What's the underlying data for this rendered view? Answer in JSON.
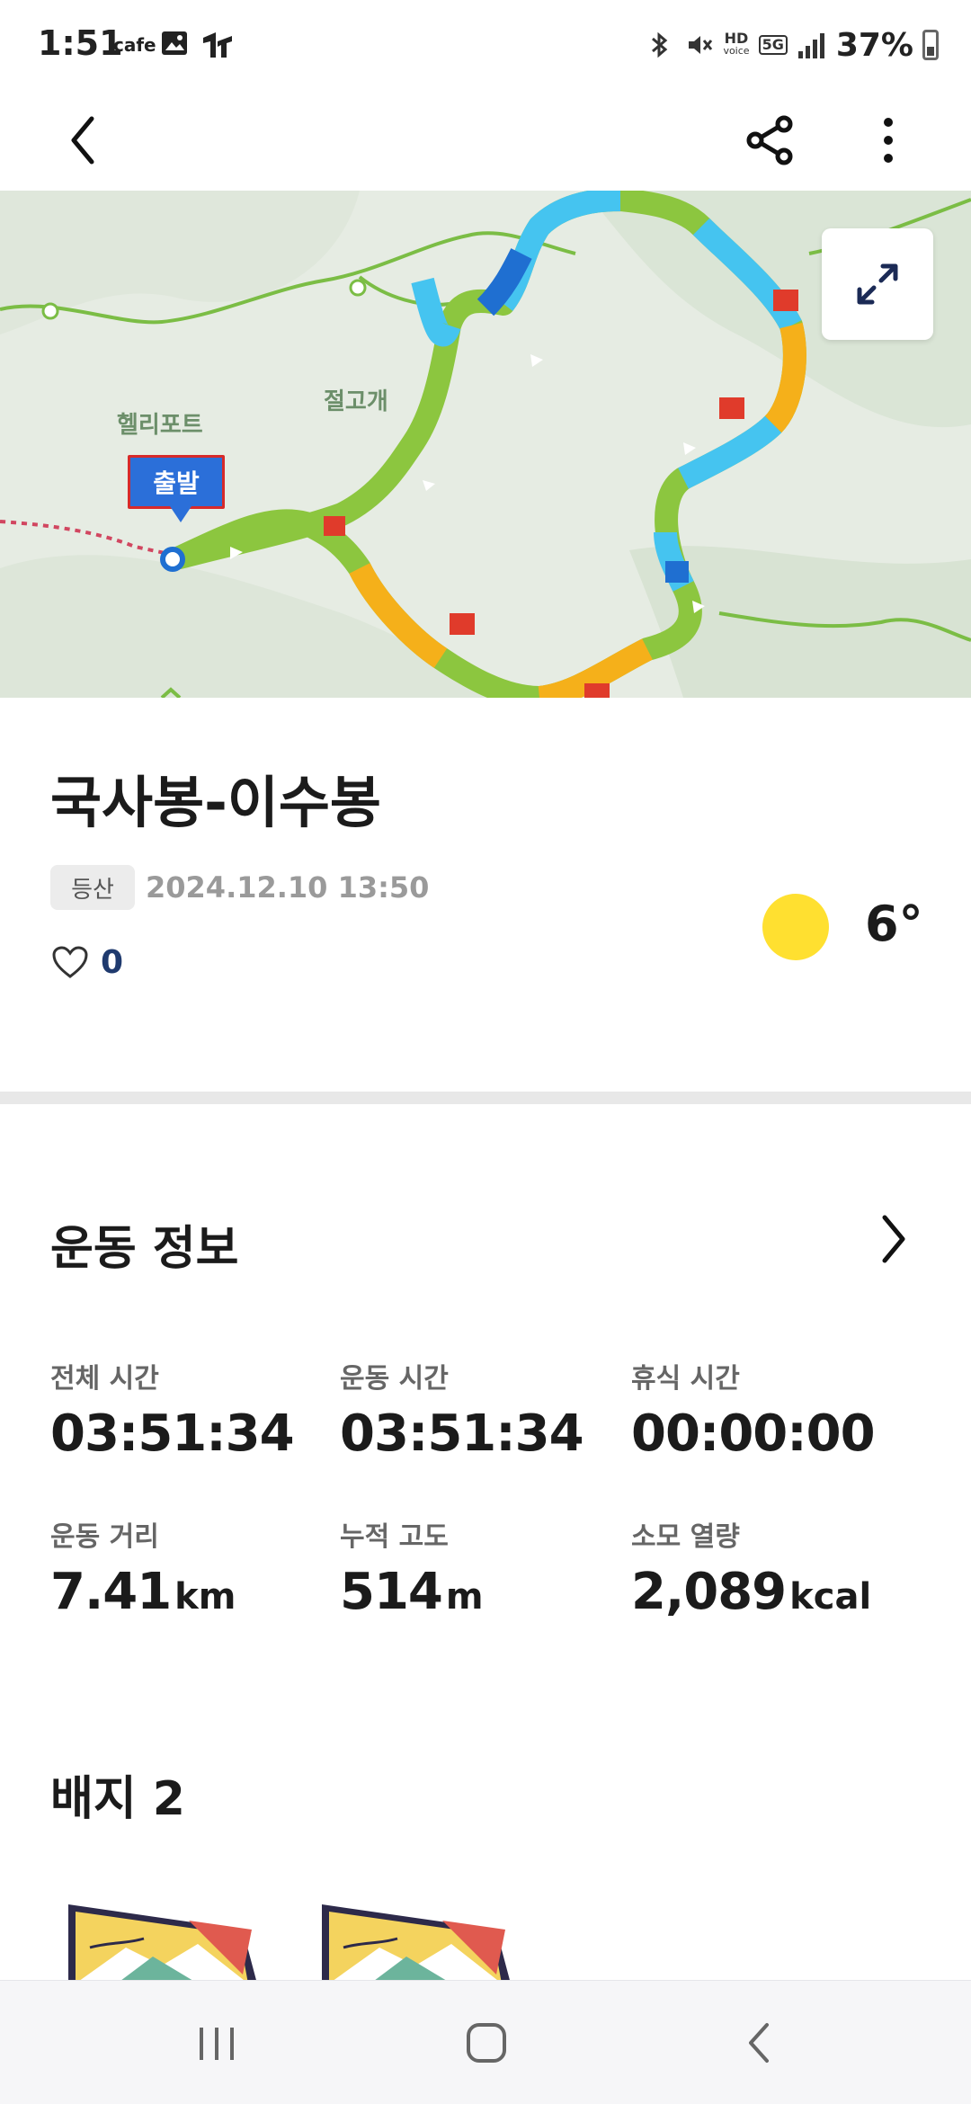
{
  "status_bar": {
    "time": "1:51",
    "cafe_label": "cafe",
    "hd_label": "HD",
    "voice_label": "voice",
    "network": "5G",
    "battery": "37%"
  },
  "app_bar": {
    "back_icon": "chevron-left-icon",
    "share_icon": "share-icon",
    "more_icon": "more-vertical-icon"
  },
  "map": {
    "labels": {
      "heliport": "헬리포트",
      "pass": "절고개"
    },
    "start_marker": "출발",
    "expand_icon": "expand-icon",
    "route_colors": [
      "#8cc63f",
      "#45c4f0",
      "#1f6fd1",
      "#f5b01a",
      "#e03b2b"
    ]
  },
  "activity": {
    "title": "국사봉-이수봉",
    "category": "등산",
    "datetime": "2024.12.10 13:50",
    "likes": "0",
    "weather_icon": "sun-icon",
    "temperature": "6°"
  },
  "exercise_info": {
    "title": "운동 정보",
    "stats": [
      {
        "label": "전체 시간",
        "value": "03:51:34",
        "unit": ""
      },
      {
        "label": "운동 시간",
        "value": "03:51:34",
        "unit": ""
      },
      {
        "label": "휴식 시간",
        "value": "00:00:00",
        "unit": ""
      },
      {
        "label": "운동 거리",
        "value": "7.41",
        "unit": "km"
      },
      {
        "label": "누적 고도",
        "value": "514",
        "unit": "m"
      },
      {
        "label": "소모 열량",
        "value": "2,089",
        "unit": "kcal"
      }
    ]
  },
  "badges": {
    "title": "배지 2"
  },
  "nav_bar": {
    "recents_icon": "recents-icon",
    "home_icon": "home-icon",
    "back_icon": "back-icon"
  }
}
